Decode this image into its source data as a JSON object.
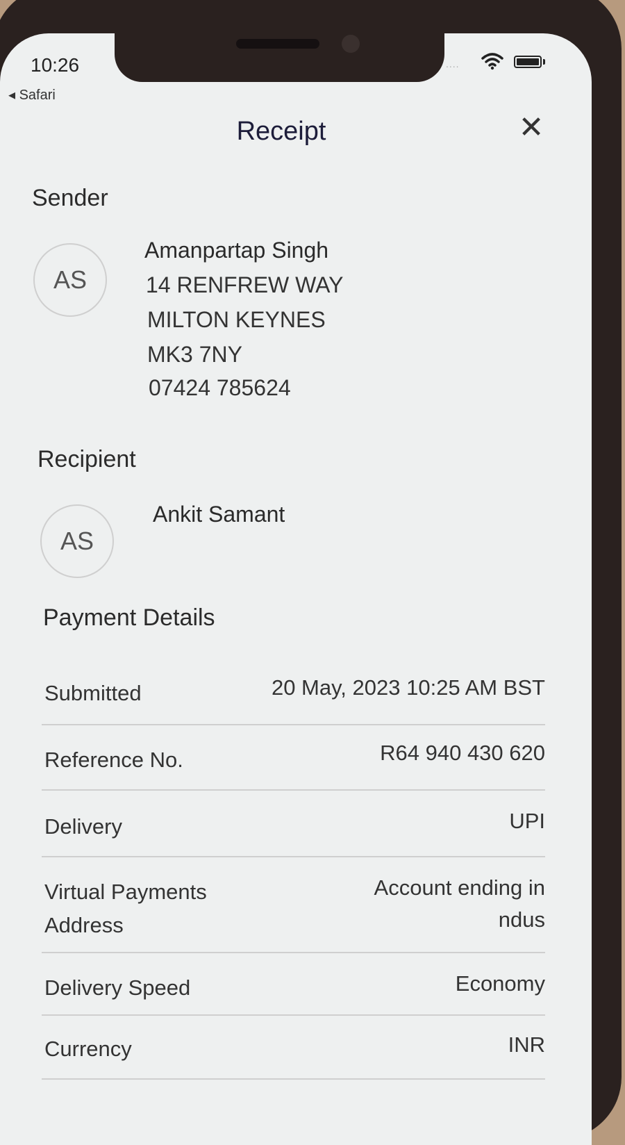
{
  "status_bar": {
    "time": "10:26",
    "back_app": "◂ Safari",
    "signal": "....",
    "icons": [
      "wifi-icon",
      "battery-icon"
    ]
  },
  "header": {
    "title": "Receipt",
    "close_symbol": "✕"
  },
  "sender": {
    "heading": "Sender",
    "initials": "AS",
    "name": "Amanpartap Singh",
    "address_line1": "14 RENFREW WAY",
    "address_line2": "MILTON KEYNES",
    "postcode": "MK3 7NY",
    "phone": "07424 785624"
  },
  "recipient": {
    "heading": "Recipient",
    "initials": "AS",
    "name": "Ankit Samant"
  },
  "payment_details": {
    "heading": "Payment Details",
    "rows": [
      {
        "label": "Submitted",
        "value": "20 May, 2023 10:25 AM BST"
      },
      {
        "label": "Reference No.",
        "value": "R64 940 430 620"
      },
      {
        "label": "Delivery",
        "value": "UPI"
      },
      {
        "label_line1": "Virtual Payments",
        "label_line2": "Address",
        "value_line1": "Account ending in",
        "value_line2": "ndus"
      },
      {
        "label": "Delivery Speed",
        "value": "Economy"
      },
      {
        "label": "Currency",
        "value": "INR"
      }
    ]
  }
}
